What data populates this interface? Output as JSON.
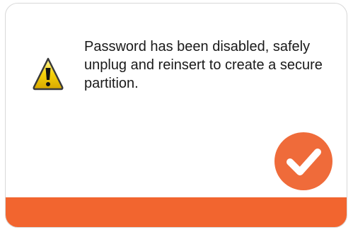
{
  "dialog": {
    "message": "Password has been disabled, safely unplug and reinsert to create a secure partition.",
    "warning_icon": "warning-triangle-icon",
    "confirm_icon": "checkmark-icon"
  },
  "colors": {
    "accent": "#f2652f",
    "button": "#ef6b3a",
    "warning_fill": "#f5d10a",
    "text": "#1a1a1a"
  }
}
